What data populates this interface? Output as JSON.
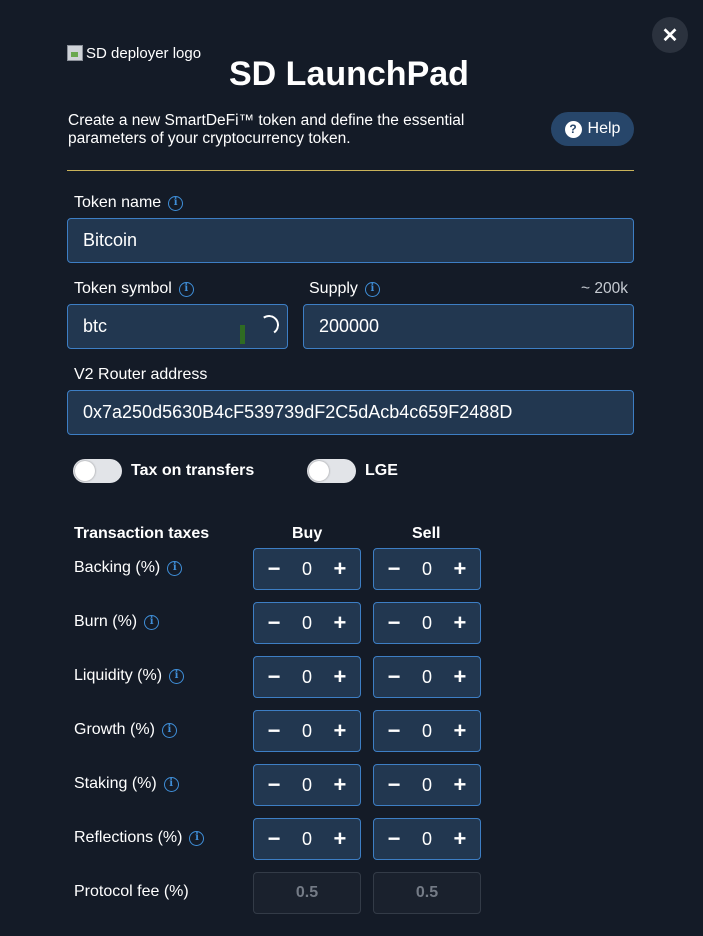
{
  "header": {
    "close_label": "✕",
    "logo_alt": "SD deployer logo",
    "title": "SD LaunchPad",
    "intro": "Create a new SmartDeFi™ token and define the essential parameters of your cryptocurrency token.",
    "help_label": "Help"
  },
  "form": {
    "token_name": {
      "label": "Token name",
      "value": "Bitcoin"
    },
    "token_symbol": {
      "label": "Token symbol",
      "value": "btc"
    },
    "supply": {
      "label": "Supply",
      "value": "200000",
      "hint": "~ 200k"
    },
    "router": {
      "label": "V2 Router address",
      "value": "0x7a250d5630B4cF539739dF2C5dAcb4c659F2488D"
    },
    "toggles": {
      "tax": {
        "label": "Tax on transfers",
        "on": false
      },
      "lge": {
        "label": "LGE",
        "on": false
      }
    }
  },
  "taxes": {
    "heading": "Transaction taxes",
    "buy_heading": "Buy",
    "sell_heading": "Sell",
    "minus": "−",
    "plus": "+",
    "rows": [
      {
        "label": "Backing (%)",
        "buy": "0",
        "sell": "0"
      },
      {
        "label": "Burn (%)",
        "buy": "0",
        "sell": "0"
      },
      {
        "label": "Liquidity (%)",
        "buy": "0",
        "sell": "0"
      },
      {
        "label": "Growth (%)",
        "buy": "0",
        "sell": "0"
      },
      {
        "label": "Staking (%)",
        "buy": "0",
        "sell": "0"
      },
      {
        "label": "Reflections (%)",
        "buy": "0",
        "sell": "0"
      }
    ],
    "protocol_fee": {
      "label": "Protocol fee (%)",
      "buy": "0.5",
      "sell": "0.5"
    }
  },
  "icons": {
    "info": "info-icon",
    "help": "question-circle-icon",
    "close": "close-icon"
  },
  "colors": {
    "background": "#141b27",
    "input_bg": "#223750",
    "input_border": "#3d7ec4",
    "accent": "#3f8fd9",
    "divider": "#c9b35a"
  }
}
